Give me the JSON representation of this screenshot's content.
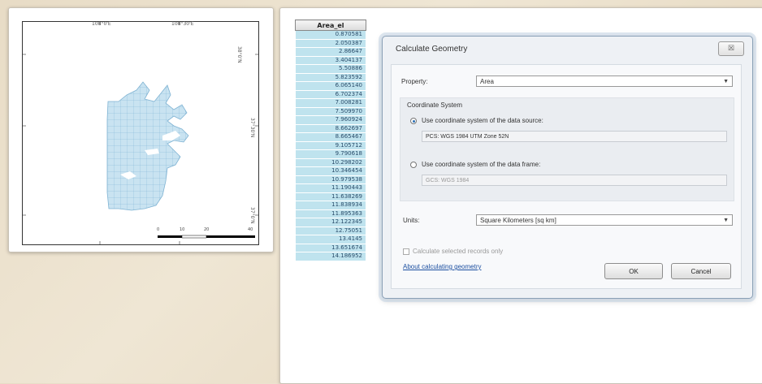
{
  "map": {
    "top_coords": [
      "108°0'E",
      "108°30'E"
    ],
    "right_coords": [
      "38°0'N",
      "37°30'N",
      "37°0'N"
    ],
    "scale_labels": [
      "0",
      "10",
      "20",
      "40"
    ]
  },
  "table": {
    "header": "Area_el",
    "rows": [
      "0.870581",
      "2.050387",
      "2.86647",
      "3.404137",
      "5.50886",
      "5.823592",
      "6.065140",
      "6.702374",
      "7.008281",
      "7.509970",
      "7.960924",
      "8.662697",
      "8.665467",
      "9.105712",
      "9.790618",
      "10.298202",
      "10.346454",
      "10.979538",
      "11.190443",
      "11.638269",
      "11.838934",
      "11.895363",
      "12.122345",
      "12.75051",
      "13.4145",
      "13.651674",
      "14.186952"
    ]
  },
  "dialog": {
    "title": "Calculate Geometry",
    "close_label": "☒",
    "property_label": "Property:",
    "property_value": "Area",
    "coord_system_label": "Coordinate System",
    "use_source_label": "Use coordinate system of the data source:",
    "source_value": "PCS: WGS 1984 UTM Zone 52N",
    "use_frame_label": "Use coordinate system of the data frame:",
    "frame_value": "GCS: WGS 1984",
    "units_label": "Units:",
    "units_value": "Square Kilometers [sq km]",
    "selected_only_label": "Calculate selected records only",
    "about_link": "About calculating geometry",
    "ok_label": "OK",
    "cancel_label": "Cancel"
  }
}
